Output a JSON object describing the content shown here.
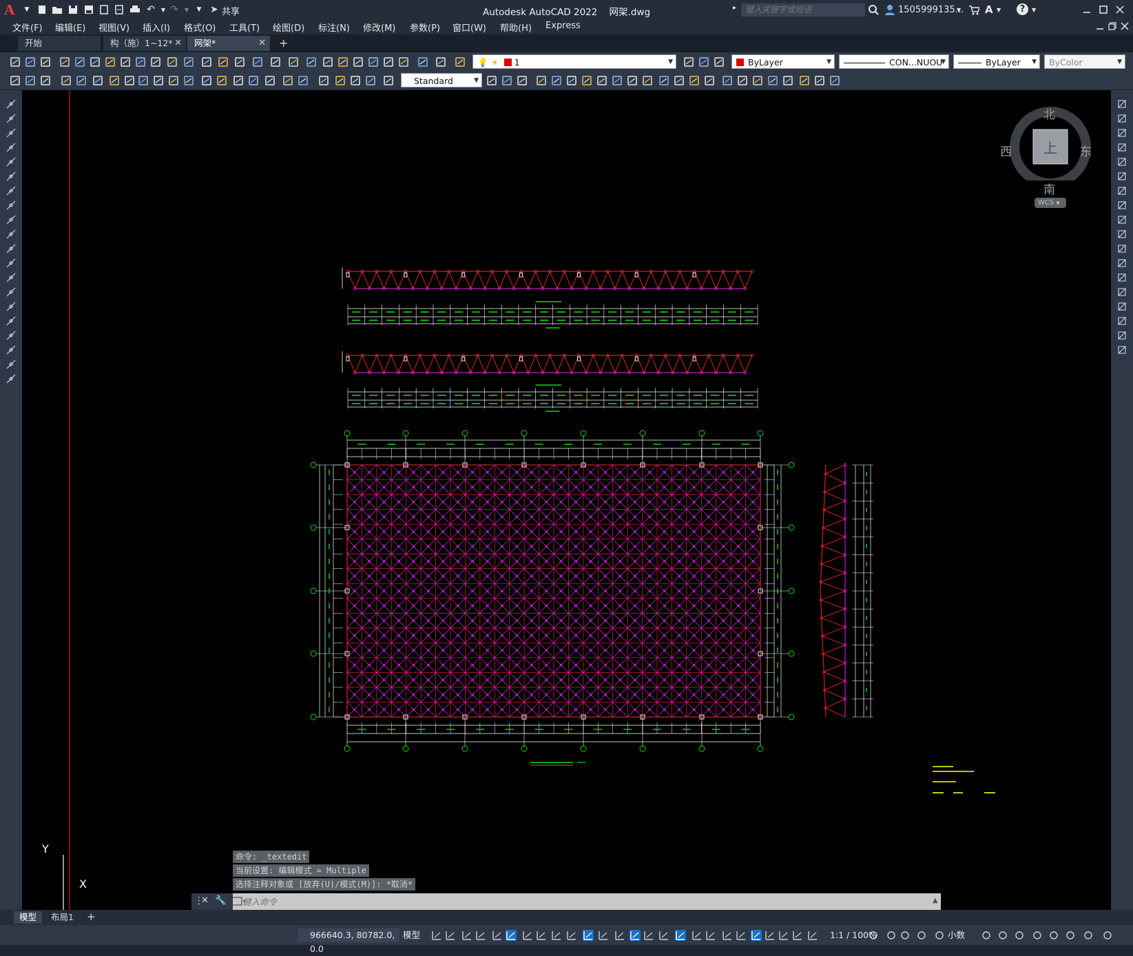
{
  "app": {
    "title": "Autodesk AutoCAD 2022",
    "filename": "网架.dwg",
    "share_label": "共享",
    "search_placeholder": "键入关键字或短语",
    "user": "1505999135...",
    "help": "?"
  },
  "menu": [
    "文件(F)",
    "编辑(E)",
    "视图(V)",
    "插入(I)",
    "格式(O)",
    "工具(T)",
    "绘图(D)",
    "标注(N)",
    "修改(M)",
    "参数(P)",
    "窗口(W)",
    "帮助(H)",
    "Express"
  ],
  "tabs": [
    {
      "label": "开始"
    },
    {
      "label": "构（施）1~12*"
    },
    {
      "label": "网架*"
    }
  ],
  "properties": {
    "layer": "1",
    "color": "ByLayer",
    "linetype": "CON...NUOU",
    "lineweight": "ByLayer",
    "plotstyle": "ByColor",
    "textstyle": "Standard"
  },
  "viewcube": {
    "north": "北",
    "south": "南",
    "east": "东",
    "west": "西",
    "top": "上",
    "wcs": "WCS"
  },
  "ucs": {
    "x": "X",
    "y": "Y"
  },
  "command": {
    "history": [
      "命令: _textedit",
      "当前设置: 编辑模式 = Multiple",
      "选择注释对象或 [放弃(U)/模式(M)]: *取消*"
    ],
    "placeholder": "键入命令"
  },
  "layout_tabs": [
    "模型",
    "布局1"
  ],
  "status": {
    "coords": "966640.3, 80782.0, 0.0",
    "space": "模型",
    "scale": "1:1 / 100%",
    "units": "小数"
  },
  "drawing_colors": {
    "top_chord": "#d12020",
    "bottom_chord": "#c020c0",
    "dimension": "#00e000",
    "frame": "#ffffff",
    "text": "#ffff00"
  }
}
